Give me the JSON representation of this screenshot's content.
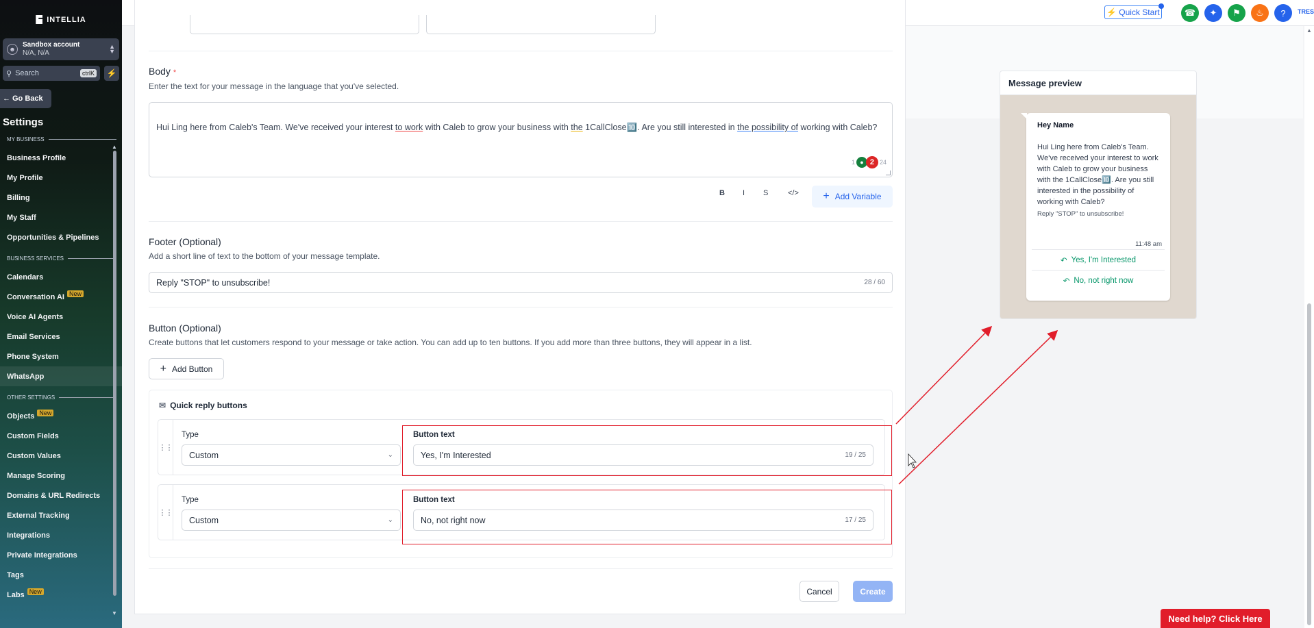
{
  "brand": {
    "name": "INTELLIA"
  },
  "account": {
    "name": "Sandbox account",
    "location": "N/A, N/A"
  },
  "search": {
    "placeholder": "Search",
    "shortcut": "ctrlK"
  },
  "sidebar": {
    "go_back": "Go Back",
    "title": "Settings",
    "sections": [
      {
        "label": "MY BUSINESS",
        "items": [
          {
            "label": "Business Profile"
          },
          {
            "label": "My Profile"
          },
          {
            "label": "Billing"
          },
          {
            "label": "My Staff"
          },
          {
            "label": "Opportunities & Pipelines"
          }
        ]
      },
      {
        "label": "BUSINESS SERVICES",
        "items": [
          {
            "label": "Calendars"
          },
          {
            "label": "Conversation AI",
            "badge": "New"
          },
          {
            "label": "Voice AI Agents"
          },
          {
            "label": "Email Services"
          },
          {
            "label": "Phone System"
          },
          {
            "label": "WhatsApp",
            "active": true
          }
        ]
      },
      {
        "label": "OTHER SETTINGS",
        "items": [
          {
            "label": "Objects",
            "badge": "New"
          },
          {
            "label": "Custom Fields"
          },
          {
            "label": "Custom Values"
          },
          {
            "label": "Manage Scoring"
          },
          {
            "label": "Domains & URL Redirects"
          },
          {
            "label": "External Tracking"
          },
          {
            "label": "Integrations"
          },
          {
            "label": "Private Integrations"
          },
          {
            "label": "Tags"
          },
          {
            "label": "Labs",
            "badge": "New"
          }
        ]
      }
    ]
  },
  "topbar": {
    "quick_start": "Quick Start",
    "user_initials": "TRES",
    "icon_colors": {
      "phone": "#16a34a",
      "magic": "#2563eb",
      "megaphone": "#16a34a",
      "bell": "#f97316",
      "help": "#2563eb"
    }
  },
  "body": {
    "label": "Body",
    "required_mark": "*",
    "hint": "Enter the text for your message in the language that you've selected.",
    "text_parts": [
      "Hui Ling here from Caleb's Team. We've received your interest ",
      "to work",
      " with Caleb to grow your business with ",
      "the",
      " 1CallClose",
      "🔟",
      ". Are you still interested in ",
      "the possibility of",
      " working with Caleb?"
    ],
    "char_count_left": "1",
    "char_count_right": "24",
    "grammarly_count": "2",
    "format": {
      "bold": "B",
      "italic": "I",
      "strike": "S",
      "code": "</>"
    },
    "add_variable": "Add Variable"
  },
  "footer": {
    "label": "Footer (Optional)",
    "hint": "Add a short line of text to the bottom of your message template.",
    "value": "Reply \"STOP\" to unsubscribe!",
    "counter": "28 / 60"
  },
  "buttons": {
    "label": "Button (Optional)",
    "hint": "Create buttons that let customers respond to your message or take action. You can add up to ten buttons. If you add more than three buttons, they will appear in a list.",
    "add_button": "Add Button",
    "quick_reply_title": "Quick reply buttons",
    "rows": [
      {
        "type_label": "Type",
        "type_value": "Custom",
        "text_label": "Button text",
        "text_value": "Yes, I'm Interested",
        "counter": "19 / 25"
      },
      {
        "type_label": "Type",
        "type_value": "Custom",
        "text_label": "Button text",
        "text_value": "No, not right now",
        "counter": "17 / 25"
      }
    ]
  },
  "actions": {
    "cancel": "Cancel",
    "create": "Create"
  },
  "preview": {
    "title": "Message preview",
    "greeting": "Hey Name",
    "body": "Hui Ling here from Caleb's Team. We've received your interest to work with Caleb to grow your business with the 1CallClose🔟. Are you still interested in the possibility of working with Caleb?",
    "footer": "Reply \"STOP\" to unsubscribe!",
    "time": "11:48 am",
    "buttons": [
      "Yes, I'm Interested",
      "No, not right now"
    ]
  },
  "help": {
    "label": "Need help? Click Here"
  },
  "colors": {
    "accent": "#2563eb",
    "annotation": "#e11d2a",
    "preview_button": "#059669"
  }
}
